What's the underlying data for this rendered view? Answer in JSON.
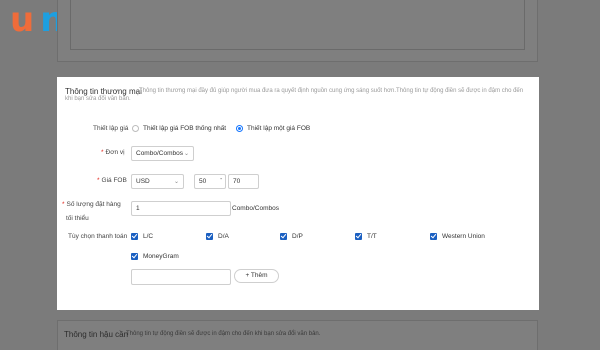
{
  "logo": {
    "letters": [
      "u",
      "n",
      "i",
      "c",
      "a"
    ]
  },
  "colors": {
    "logo_orange": "#ef6c3a",
    "logo_blue": "#1d9fe0",
    "accent": "#1677ff",
    "checkbox": "#1a5fc1",
    "required": "#e2231a"
  },
  "section": {
    "title": "Thông tin thương mại",
    "desc_line1": "Thông tin thương mại đầy đủ giúp người mua đưa ra quyết định nguồn cung ứng sáng suốt hơn.Thông tin tự động điền sẽ được in đậm cho đến",
    "desc_line2": "khi bạn sửa đổi văn bản."
  },
  "pricing_setup": {
    "label": "Thiết lập giá",
    "options": [
      {
        "text": "Thiết lập giá FOB thống nhất",
        "selected": false
      },
      {
        "text": "Thiết lập một giá FOB",
        "selected": true
      }
    ]
  },
  "unit": {
    "label": "Đơn vị",
    "value": "Combo/Combos"
  },
  "fob_price": {
    "label": "Giá FOB",
    "currency": "USD",
    "min": "50",
    "separator": "-",
    "max": "70"
  },
  "min_order": {
    "label_line1": "Số lượng đặt hàng",
    "label_line2": "tối thiểu",
    "value": "1",
    "unit": "Combo/Combos"
  },
  "payment": {
    "label": "Tùy chọn thanh toán",
    "options": [
      "L/C",
      "D/A",
      "D/P",
      "T/T",
      "Western Union",
      "MoneyGram"
    ],
    "other_placeholder": "",
    "add_label": "+ Thêm"
  },
  "next_section": {
    "title": "Thông tin hậu cần",
    "desc": "Thông tin tự động điền sẽ được in đậm cho đến khi bạn sửa đổi văn bản."
  }
}
